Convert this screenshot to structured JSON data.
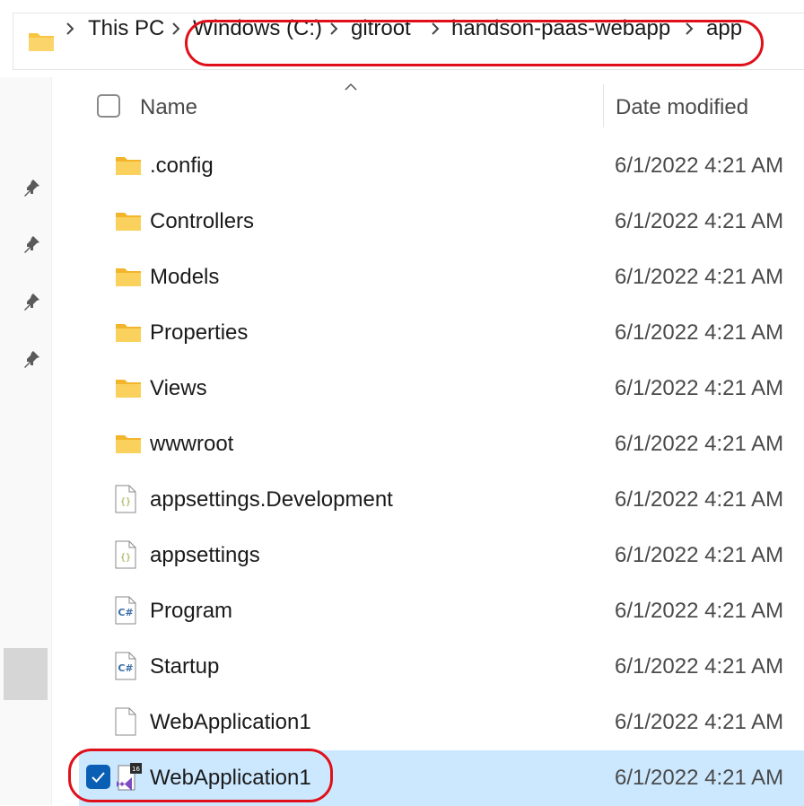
{
  "breadcrumb": {
    "items": [
      {
        "label": "This PC"
      },
      {
        "label": "Windows (C:)"
      },
      {
        "label": "gitroot"
      },
      {
        "label": "handson-paas-webapp"
      },
      {
        "label": "app"
      }
    ]
  },
  "columns": {
    "name": "Name",
    "date_modified": "Date modified"
  },
  "files": [
    {
      "name": ".config",
      "date": "6/1/2022 4:21 AM",
      "icon": "folder-icon"
    },
    {
      "name": "Controllers",
      "date": "6/1/2022 4:21 AM",
      "icon": "folder-icon"
    },
    {
      "name": "Models",
      "date": "6/1/2022 4:21 AM",
      "icon": "folder-icon"
    },
    {
      "name": "Properties",
      "date": "6/1/2022 4:21 AM",
      "icon": "folder-icon"
    },
    {
      "name": "Views",
      "date": "6/1/2022 4:21 AM",
      "icon": "folder-icon"
    },
    {
      "name": "wwwroot",
      "date": "6/1/2022 4:21 AM",
      "icon": "folder-icon"
    },
    {
      "name": "appsettings.Development",
      "date": "6/1/2022 4:21 AM",
      "icon": "json-file-icon"
    },
    {
      "name": "appsettings",
      "date": "6/1/2022 4:21 AM",
      "icon": "json-file-icon"
    },
    {
      "name": "Program",
      "date": "6/1/2022 4:21 AM",
      "icon": "csharp-file-icon"
    },
    {
      "name": "Startup",
      "date": "6/1/2022 4:21 AM",
      "icon": "csharp-file-icon"
    },
    {
      "name": "WebApplication1",
      "date": "6/1/2022 4:21 AM",
      "icon": "blank-file-icon"
    },
    {
      "name": "WebApplication1",
      "date": "6/1/2022 4:21 AM",
      "icon": "visual-studio-solution-icon",
      "selected": true,
      "badge": "16"
    }
  ],
  "colors": {
    "highlight": "#e0101a",
    "selection": "#cce8ff",
    "checkbox": "#0a5fb4",
    "folder": "#f8c640"
  }
}
